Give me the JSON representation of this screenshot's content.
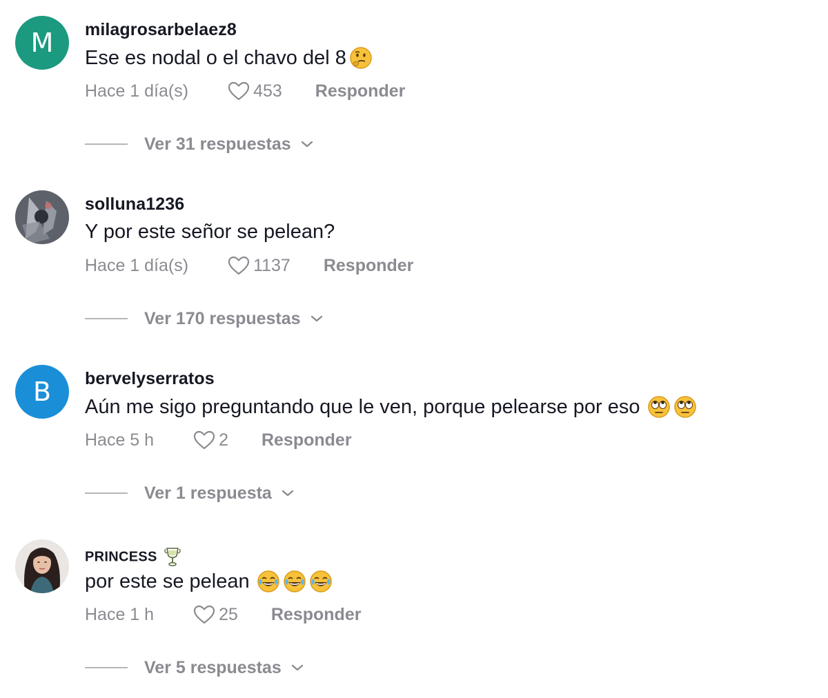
{
  "comments": [
    {
      "avatar_letter": "M",
      "avatar_color": "#1b9a7f",
      "username": "milagrosarbelaez8",
      "text": "Ese es nodal o el chavo del 8",
      "text_emoji": "thinking-face",
      "time": "Hace 1 día(s)",
      "likes": "453",
      "reply_label": "Responder",
      "view_replies": "Ver 31 respuestas"
    },
    {
      "avatar_image": "avatar-photo-icon",
      "username": "solluna1236",
      "text": "Y por este señor se pelean?",
      "time": "Hace 1 día(s)",
      "likes": "1137",
      "reply_label": "Responder",
      "view_replies": "Ver 170 respuestas"
    },
    {
      "avatar_letter": "B",
      "avatar_color": "#1a8fd8",
      "username": "bervelyserratos",
      "text": "Aún me sigo preguntando que le ven, porque pelearse por eso",
      "text_emoji": "face-with-rolling-eyes x2",
      "time": "Hace 5 h",
      "likes": "2",
      "reply_label": "Responder",
      "view_replies": "Ver 1 respuesta"
    },
    {
      "avatar_image": "avatar-photo-icon",
      "username": "PRINCESS",
      "username_emoji": "trophy-icon",
      "text": "por este se pelean",
      "text_emoji": "face-with-tears-of-joy x3",
      "time": "Hace 1 h",
      "likes": "25",
      "reply_label": "Responder",
      "view_replies": "Ver 5 respuestas"
    }
  ],
  "colors": {
    "text_primary": "#161823",
    "text_secondary": "#8a8b91"
  }
}
